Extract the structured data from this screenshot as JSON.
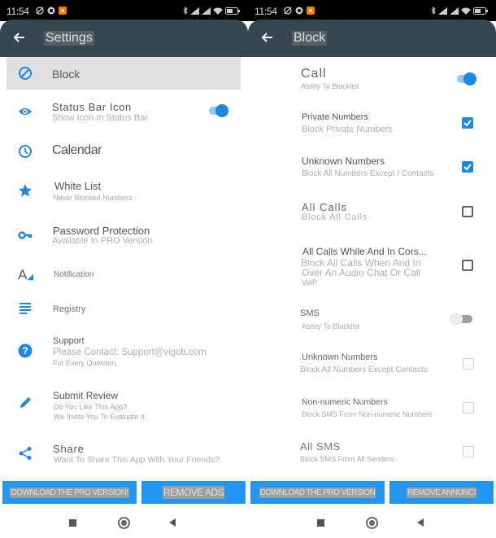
{
  "status_bar": {
    "time": "11:54",
    "left_icons": [
      "alarm-off-icon",
      "vpn-shield-icon",
      "app-notification-icon"
    ],
    "right_icons": [
      "bluetooth-icon",
      "signal-icon",
      "signal-icon",
      "wifi-icon",
      "battery-icon"
    ],
    "battery": "48"
  },
  "colors": {
    "appbar": "#37474f",
    "accent": "#1e88e5",
    "button": "#2196f3"
  },
  "left": {
    "appbar": {
      "title": "Settings",
      "back_icon": "arrow-left-icon"
    },
    "items": [
      {
        "icon": "block-icon",
        "title": "Block",
        "selected": true
      },
      {
        "icon": "eye-icon",
        "title": "Status Bar Icon",
        "subtitle": "Show Icon In Status Bar",
        "toggle": true
      },
      {
        "icon": "clock-icon",
        "title": "Calendar"
      },
      {
        "icon": "star-icon",
        "title": "White List",
        "subtitle": "Never Blocked Numbers"
      },
      {
        "icon": "key-icon",
        "title": "Password Protection",
        "subtitle": "Available In PRO Version"
      },
      {
        "icon": "font-icon",
        "title": "Notification"
      },
      {
        "icon": "list-icon",
        "title": "Registry"
      },
      {
        "icon": "help-icon",
        "title": "Support",
        "subtitle": "Please Contact: Support@vigob.com",
        "subtitle2": "For Every Question."
      },
      {
        "icon": "pencil-icon",
        "title": "Submit Review",
        "subtitle": "Do You Like This App?",
        "subtitle2": "We Invite You To Evaluate It."
      },
      {
        "icon": "share-icon",
        "title": "Share",
        "subtitle": "Want To Share This App With Your Friends?"
      }
    ],
    "buttons": {
      "pro": "DOWNLOAD THE PRO VERSION!",
      "ads": "REMOVE ADS"
    }
  },
  "right": {
    "appbar": {
      "title": "Block",
      "back_icon": "arrow-left-icon"
    },
    "items": [
      {
        "title": "Call",
        "subtitle": "Ability To Blacklist",
        "control": "toggle",
        "on": true
      },
      {
        "title": "Private Numbers",
        "subtitle": "Block Private Numbers",
        "control": "checkbox",
        "checked": true
      },
      {
        "title": "Unknown Numbers",
        "subtitle": "Block All Numbers Except / Contacts",
        "control": "checkbox",
        "checked": true
      },
      {
        "title": "All Calls",
        "subtitle": "Block All Calls",
        "control": "checkbox",
        "checked": false
      },
      {
        "title": "All Calls While And In Cors...",
        "subtitle": "Block All Calls When And In",
        "subtitle2": "Over An Audio Chat Or Call",
        "subtitle3": "VoIP",
        "control": "checkbox",
        "checked": false
      },
      {
        "title": "SMS",
        "subtitle": "Ability To Blacklist",
        "control": "toggle",
        "on": false
      },
      {
        "title": "Unknown Numbers",
        "subtitle": "Block All Numbers Except Contacts",
        "control": "checkbox",
        "checked": false,
        "disabled": true
      },
      {
        "title": "Non-numeric Numbers",
        "subtitle": "Block SMS From Non-numeric Numbers",
        "control": "checkbox",
        "checked": false,
        "disabled": true
      },
      {
        "title": "All SMS",
        "subtitle": "Block SMS From All Senders",
        "control": "checkbox",
        "checked": false,
        "disabled": true
      }
    ],
    "buttons": {
      "pro": "DOWNLOAD THE PRO VERSION",
      "ads": "REMOVE ANNUNCI"
    }
  },
  "navbar": {
    "recents": "recents-square-icon",
    "home": "home-circle-icon",
    "back": "back-triangle-icon"
  }
}
